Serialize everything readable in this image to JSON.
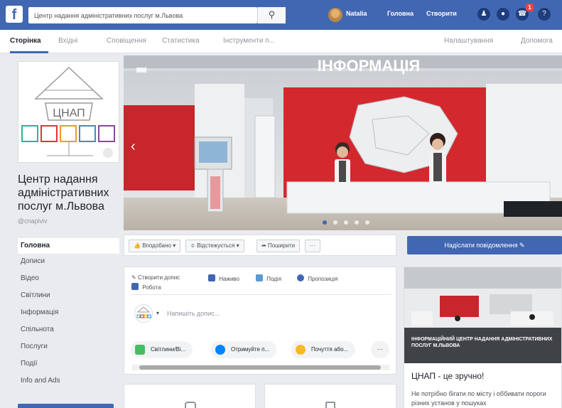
{
  "topbar": {
    "logo": "f",
    "search_value": "Центр надання адміністративних послуг м.Львова",
    "search_icon": "search-icon",
    "user_name": "Natalia",
    "home_label": "Головна",
    "create_label": "Створити",
    "icons": [
      "friends-icon",
      "messenger-icon",
      "notifications-icon",
      "help-icon"
    ],
    "notification_count": "1",
    "brand_color": "#4267b2"
  },
  "subnav": {
    "items": [
      "Сторінка",
      "Вхідні",
      "Сповіщення",
      "Статистика",
      "Інструменти п..."
    ],
    "right_items": [
      "Налаштування",
      "Допомога"
    ]
  },
  "sidebar": {
    "logo_text": "ЦНАП",
    "page_name": "Центр надання адміністративних послуг м.Львова",
    "handle": "@cnaplviv",
    "nav": [
      "Головна",
      "Дописи",
      "Відео",
      "Світлини",
      "Інформація",
      "Спільнота",
      "Послуги",
      "Події",
      "Info and Ads"
    ]
  },
  "cover": {
    "sign": "ІНФОРМАЦІЯ",
    "slides": 5,
    "active_slide": 1
  },
  "actions": {
    "like": "Вподобано",
    "follow": "Відстежується",
    "share": "Поширити",
    "more": "···",
    "send_message": "Надіслати повідомлення"
  },
  "composer": {
    "tabs": [
      "Створити допис",
      "Наживо",
      "Подія",
      "Пропозиція",
      "Робота"
    ],
    "placeholder": "Напишіть допис...",
    "pills": [
      "Світлини/Ві...",
      "Отримуйте п...",
      "Почуття або..."
    ],
    "more": "···"
  },
  "right_card": {
    "caption": "Інформаційний центр надання адміністративних послуг м.Львова",
    "title": "ЦНАП - це зручно!",
    "text": "Не потрібно бігати по місту і оббивати пороги різних установ у пошуках"
  }
}
